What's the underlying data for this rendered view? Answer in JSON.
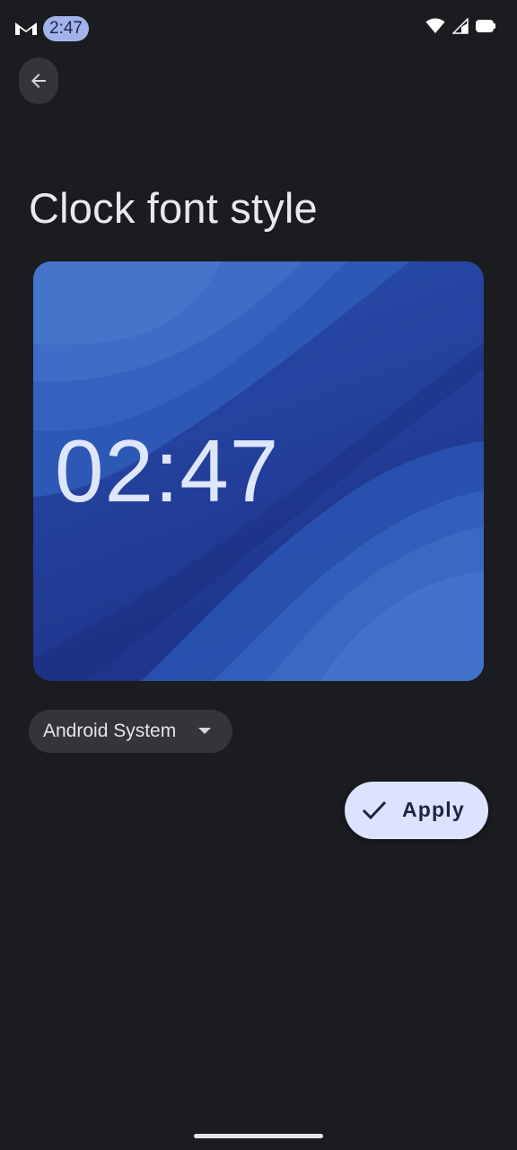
{
  "status_bar": {
    "time": "2:47",
    "icons": [
      "mail-icon",
      "wifi-icon",
      "cellular-signal-icon",
      "battery-icon"
    ]
  },
  "header": {
    "back_icon": "arrow-back-icon",
    "title": "Clock font style"
  },
  "preview": {
    "clock_time": "02:47"
  },
  "font_selector": {
    "selected": "Android System",
    "icon": "dropdown-caret-icon"
  },
  "apply_button": {
    "label": "Apply",
    "icon": "check-icon"
  },
  "colors": {
    "background": "#1b1c20",
    "surface": "#33353b",
    "accent_pill": "#a3b3ea",
    "apply_button_bg": "#dde3ff",
    "wallpaper_blue": "#2a4fad"
  }
}
